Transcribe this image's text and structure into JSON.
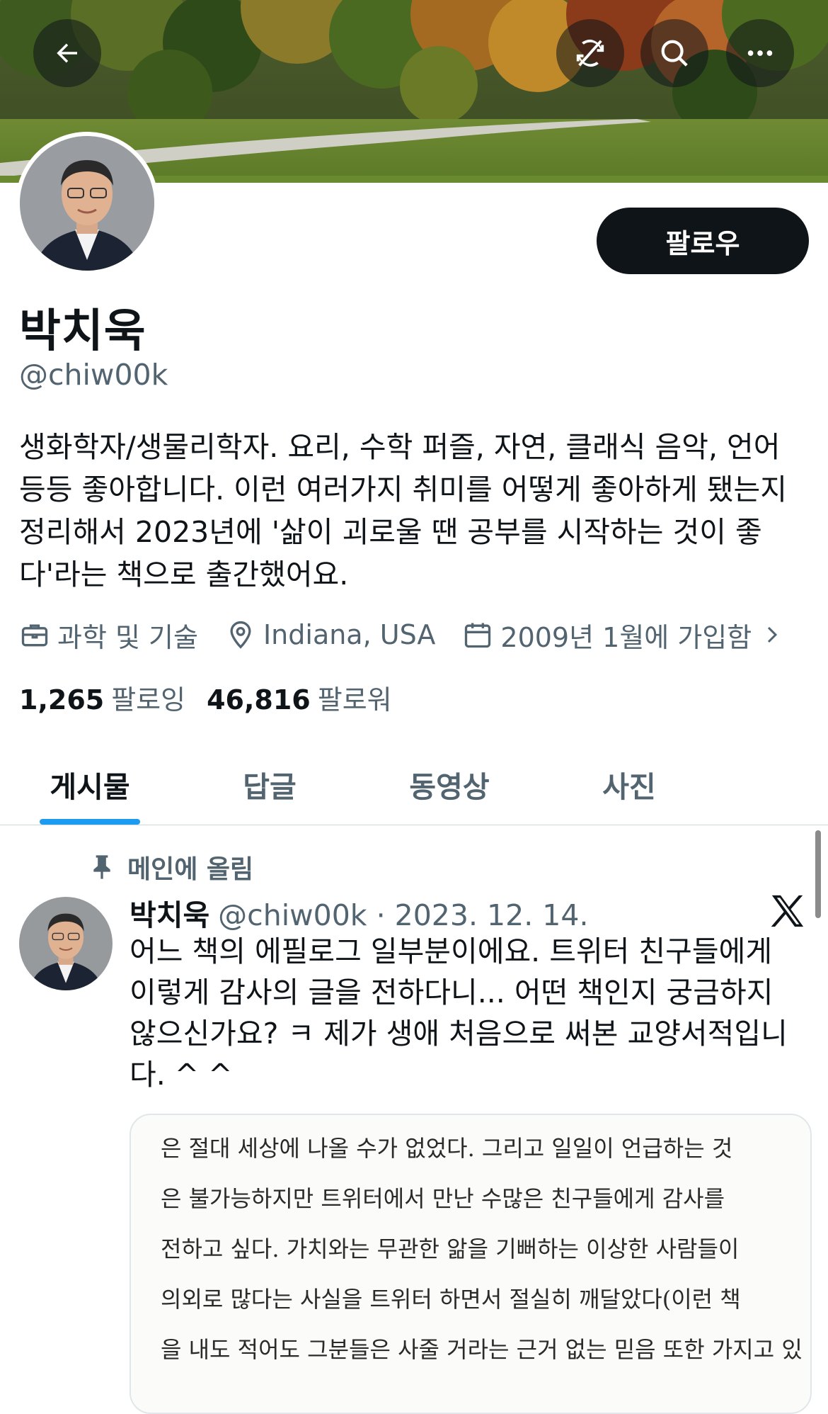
{
  "header": {
    "back_icon": "arrow-left-icon",
    "icons": [
      "sync-off-icon",
      "search-icon",
      "more-icon"
    ]
  },
  "profile": {
    "name": "박치욱",
    "handle": "@chiw00k",
    "follow_label": "팔로우",
    "bio": "생화학자/생물리학자. 요리, 수학 퍼즐, 자연, 클래식 음악, 언어\n등등 좋아합니다. 이런 여러가지 취미를 어떻게 좋아하게 됐는지\n정리해서 2023년에 '삶이 괴로울 땐 공부를 시작하는 것이 좋\n다'라는 책으로 출간했어요.",
    "category": "과학 및 기술",
    "location": "Indiana, USA",
    "joined": "2009년 1월에 가입함",
    "following_count": "1,265",
    "following_label": "팔로잉",
    "followers_count": "46,816",
    "followers_label": "팔로워"
  },
  "tabs": [
    {
      "label": "게시물",
      "active": true
    },
    {
      "label": "답글",
      "active": false
    },
    {
      "label": "동영상",
      "active": false
    },
    {
      "label": "사진",
      "active": false
    }
  ],
  "tweet": {
    "pinned_label": "메인에 올림",
    "author": "박치욱",
    "handle_date": "@chiw00k · 2023. 12. 14.",
    "text": "어느 책의 에필로그 일부분이에요. 트위터 친구들에게\n이렇게 감사의 글을 전하다니... 어떤 책인지 궁금하지\n않으신가요? ㅋ 제가 생애 처음으로 써본 교양서적입니\n다. ^ ^",
    "quote_lines": [
      "은 절대 세상에 나올 수가 없었다. 그리고 일일이 언급하는 것",
      "은 불가능하지만 트위터에서 만난 수많은 친구들에게 감사를",
      "전하고 싶다. 가치와는 무관한 앎을 기뻐하는 이상한 사람들이",
      "의외로 많다는 사실을 트위터 하면서 절실히 깨달았다(이런 책",
      "을 내도 적어도 그분들은 사줄 거라는 근거 없는 믿음 또한 가지고 있"
    ]
  },
  "colors": {
    "accent": "#1d9bf0",
    "text_primary": "#0f1419",
    "text_secondary": "#536471",
    "button_dark": "#0f1419"
  }
}
